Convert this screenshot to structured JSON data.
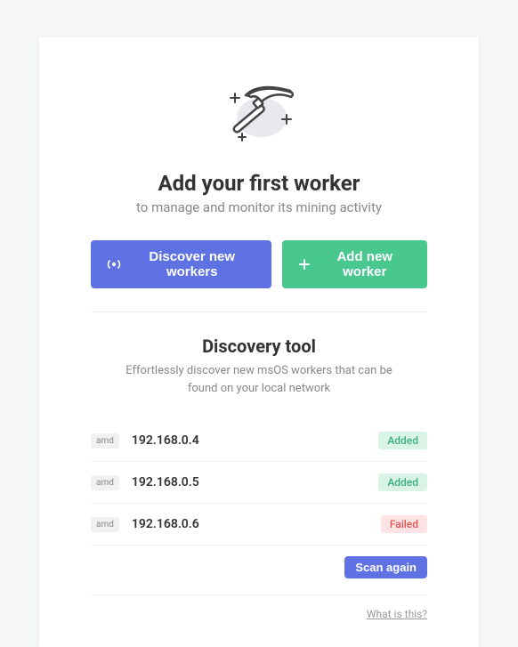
{
  "header": {
    "title": "Add your first worker",
    "subtitle": "to manage and monitor its mining activity"
  },
  "actions": {
    "discover_label": "Discover new workers",
    "add_label": "Add new worker"
  },
  "discovery": {
    "title": "Discovery tool",
    "subtitle": "Effortlessly discover new msOS workers that can be found on your local network",
    "scan_label": "Scan again",
    "help_link": "What is this?",
    "workers": [
      {
        "tag": "amd",
        "ip": "192.168.0.4",
        "status": "Added",
        "status_type": "added"
      },
      {
        "tag": "amd",
        "ip": "192.168.0.5",
        "status": "Added",
        "status_type": "added"
      },
      {
        "tag": "amd",
        "ip": "192.168.0.6",
        "status": "Failed",
        "status_type": "failed"
      }
    ]
  }
}
